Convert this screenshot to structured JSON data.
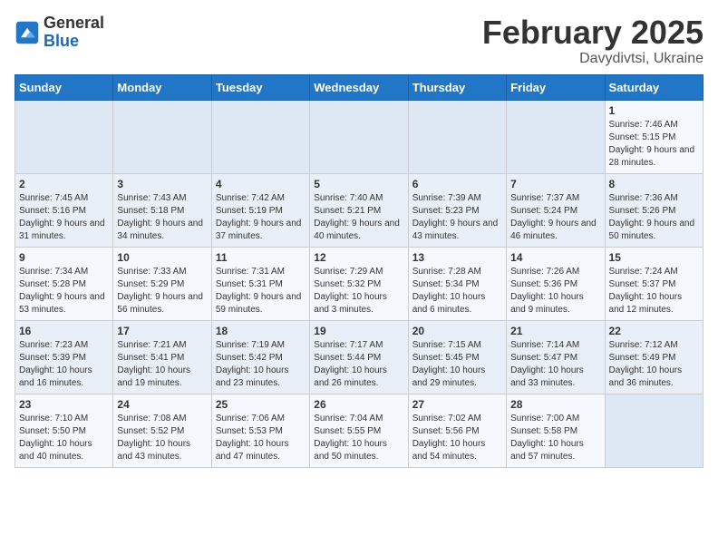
{
  "logo": {
    "general": "General",
    "blue": "Blue"
  },
  "title": "February 2025",
  "subtitle": "Davydivtsi, Ukraine",
  "days_header": [
    "Sunday",
    "Monday",
    "Tuesday",
    "Wednesday",
    "Thursday",
    "Friday",
    "Saturday"
  ],
  "weeks": [
    [
      {
        "day": "",
        "info": ""
      },
      {
        "day": "",
        "info": ""
      },
      {
        "day": "",
        "info": ""
      },
      {
        "day": "",
        "info": ""
      },
      {
        "day": "",
        "info": ""
      },
      {
        "day": "",
        "info": ""
      },
      {
        "day": "1",
        "info": "Sunrise: 7:46 AM\nSunset: 5:15 PM\nDaylight: 9 hours and 28 minutes."
      }
    ],
    [
      {
        "day": "2",
        "info": "Sunrise: 7:45 AM\nSunset: 5:16 PM\nDaylight: 9 hours and 31 minutes."
      },
      {
        "day": "3",
        "info": "Sunrise: 7:43 AM\nSunset: 5:18 PM\nDaylight: 9 hours and 34 minutes."
      },
      {
        "day": "4",
        "info": "Sunrise: 7:42 AM\nSunset: 5:19 PM\nDaylight: 9 hours and 37 minutes."
      },
      {
        "day": "5",
        "info": "Sunrise: 7:40 AM\nSunset: 5:21 PM\nDaylight: 9 hours and 40 minutes."
      },
      {
        "day": "6",
        "info": "Sunrise: 7:39 AM\nSunset: 5:23 PM\nDaylight: 9 hours and 43 minutes."
      },
      {
        "day": "7",
        "info": "Sunrise: 7:37 AM\nSunset: 5:24 PM\nDaylight: 9 hours and 46 minutes."
      },
      {
        "day": "8",
        "info": "Sunrise: 7:36 AM\nSunset: 5:26 PM\nDaylight: 9 hours and 50 minutes."
      }
    ],
    [
      {
        "day": "9",
        "info": "Sunrise: 7:34 AM\nSunset: 5:28 PM\nDaylight: 9 hours and 53 minutes."
      },
      {
        "day": "10",
        "info": "Sunrise: 7:33 AM\nSunset: 5:29 PM\nDaylight: 9 hours and 56 minutes."
      },
      {
        "day": "11",
        "info": "Sunrise: 7:31 AM\nSunset: 5:31 PM\nDaylight: 9 hours and 59 minutes."
      },
      {
        "day": "12",
        "info": "Sunrise: 7:29 AM\nSunset: 5:32 PM\nDaylight: 10 hours and 3 minutes."
      },
      {
        "day": "13",
        "info": "Sunrise: 7:28 AM\nSunset: 5:34 PM\nDaylight: 10 hours and 6 minutes."
      },
      {
        "day": "14",
        "info": "Sunrise: 7:26 AM\nSunset: 5:36 PM\nDaylight: 10 hours and 9 minutes."
      },
      {
        "day": "15",
        "info": "Sunrise: 7:24 AM\nSunset: 5:37 PM\nDaylight: 10 hours and 12 minutes."
      }
    ],
    [
      {
        "day": "16",
        "info": "Sunrise: 7:23 AM\nSunset: 5:39 PM\nDaylight: 10 hours and 16 minutes."
      },
      {
        "day": "17",
        "info": "Sunrise: 7:21 AM\nSunset: 5:41 PM\nDaylight: 10 hours and 19 minutes."
      },
      {
        "day": "18",
        "info": "Sunrise: 7:19 AM\nSunset: 5:42 PM\nDaylight: 10 hours and 23 minutes."
      },
      {
        "day": "19",
        "info": "Sunrise: 7:17 AM\nSunset: 5:44 PM\nDaylight: 10 hours and 26 minutes."
      },
      {
        "day": "20",
        "info": "Sunrise: 7:15 AM\nSunset: 5:45 PM\nDaylight: 10 hours and 29 minutes."
      },
      {
        "day": "21",
        "info": "Sunrise: 7:14 AM\nSunset: 5:47 PM\nDaylight: 10 hours and 33 minutes."
      },
      {
        "day": "22",
        "info": "Sunrise: 7:12 AM\nSunset: 5:49 PM\nDaylight: 10 hours and 36 minutes."
      }
    ],
    [
      {
        "day": "23",
        "info": "Sunrise: 7:10 AM\nSunset: 5:50 PM\nDaylight: 10 hours and 40 minutes."
      },
      {
        "day": "24",
        "info": "Sunrise: 7:08 AM\nSunset: 5:52 PM\nDaylight: 10 hours and 43 minutes."
      },
      {
        "day": "25",
        "info": "Sunrise: 7:06 AM\nSunset: 5:53 PM\nDaylight: 10 hours and 47 minutes."
      },
      {
        "day": "26",
        "info": "Sunrise: 7:04 AM\nSunset: 5:55 PM\nDaylight: 10 hours and 50 minutes."
      },
      {
        "day": "27",
        "info": "Sunrise: 7:02 AM\nSunset: 5:56 PM\nDaylight: 10 hours and 54 minutes."
      },
      {
        "day": "28",
        "info": "Sunrise: 7:00 AM\nSunset: 5:58 PM\nDaylight: 10 hours and 57 minutes."
      },
      {
        "day": "",
        "info": ""
      }
    ]
  ]
}
